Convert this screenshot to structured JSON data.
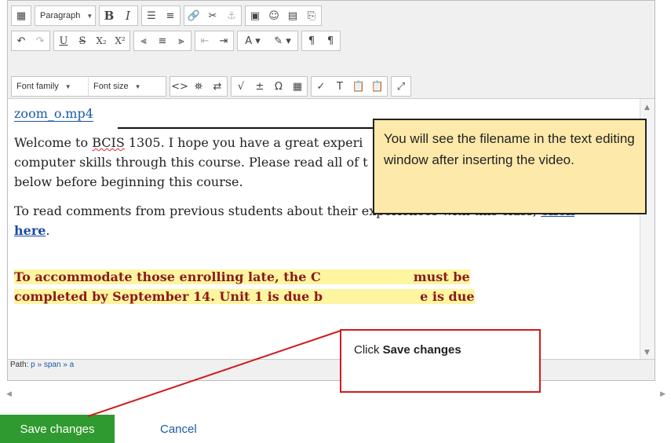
{
  "toolbar": {
    "format_select": "Paragraph",
    "font_family_select": "Font family",
    "font_size_select": "Font size",
    "bold": "B",
    "italic": "I",
    "underline": "U",
    "strike": "S",
    "subscript": "X₂",
    "superscript": "X²",
    "omega": "Ω"
  },
  "content": {
    "filename": "zoom_o.mp4",
    "para1_a": "Welcome to ",
    "para1_course": "BCIS",
    "para1_b": " 1305. I hope you have a great experi",
    "para1_c": "computer skills through this course. Please read all of t",
    "para1_d": "below before beginning this course.",
    "para2": "To read comments from previous students about their experiences with this class, ",
    "para2_link1": "click",
    "para2_link2": "here",
    "para2_end": ".",
    "para3_line1_a": "To accommodate those enrolling late, the C",
    "para3_line1_b": "must be",
    "para3_line2_a": "completed by September 14. Unit 1 is due b",
    "para3_line2_b": "e is due"
  },
  "statusbar": {
    "path_label": "Path:",
    "path": "p » span » a"
  },
  "actions": {
    "save": "Save changes",
    "cancel": "Cancel"
  },
  "callouts": {
    "filename_note": "You will see the filename in the text editing window after inserting the video.",
    "save_note_prefix": "Click ",
    "save_note_bold": "Save changes"
  }
}
